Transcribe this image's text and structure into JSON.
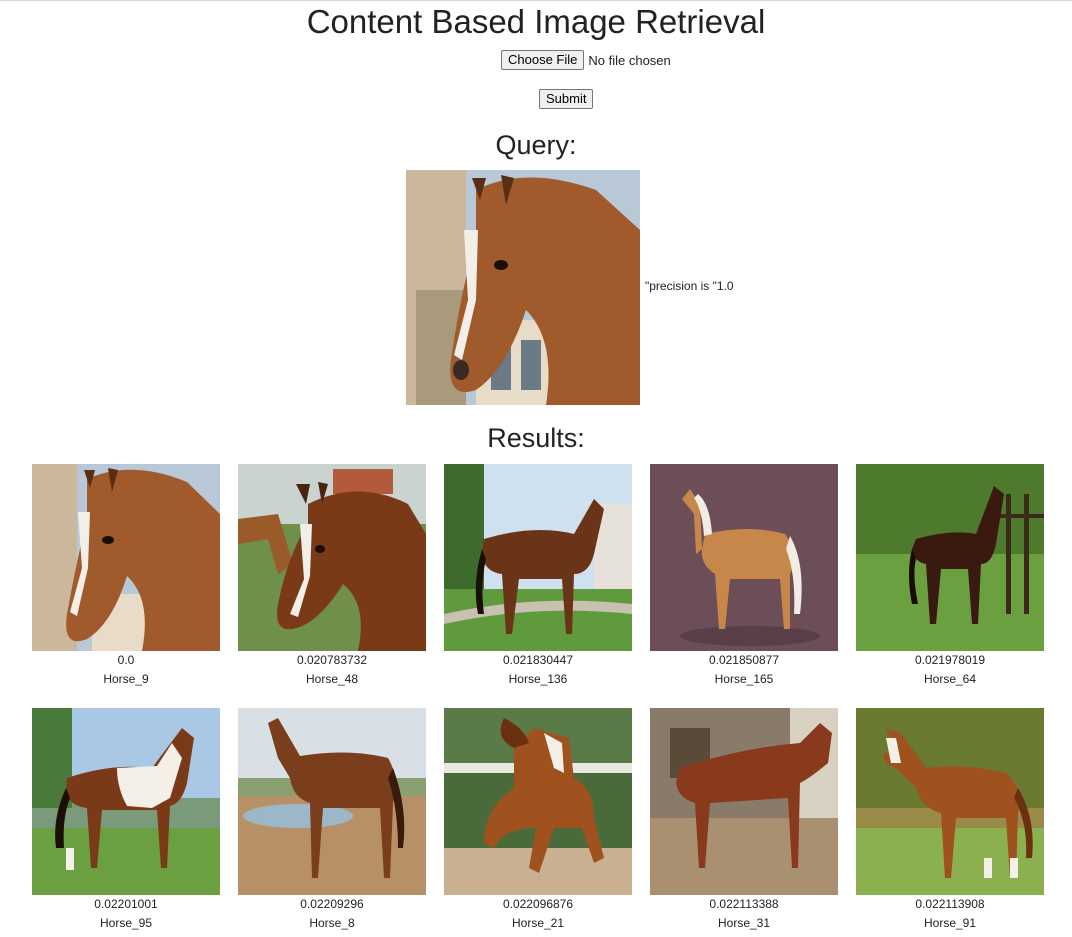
{
  "page": {
    "title": "Content Based Image Retrieval"
  },
  "upload": {
    "choose_label": "Choose File",
    "status": "No file chosen",
    "submit_label": "Submit"
  },
  "query": {
    "heading": "Query:",
    "precision_text": "\"precision is \"1.0"
  },
  "results": {
    "heading": "Results:",
    "items": [
      {
        "score": "0.0",
        "name": "Horse_9"
      },
      {
        "score": "0.020783732",
        "name": "Horse_48"
      },
      {
        "score": "0.021830447",
        "name": "Horse_136"
      },
      {
        "score": "0.021850877",
        "name": "Horse_165"
      },
      {
        "score": "0.021978019",
        "name": "Horse_64"
      },
      {
        "score": "0.02201001",
        "name": "Horse_95"
      },
      {
        "score": "0.02209296",
        "name": "Horse_8"
      },
      {
        "score": "0.022096876",
        "name": "Horse_21"
      },
      {
        "score": "0.022113388",
        "name": "Horse_31"
      },
      {
        "score": "0.022113908",
        "name": "Horse_91"
      }
    ]
  }
}
